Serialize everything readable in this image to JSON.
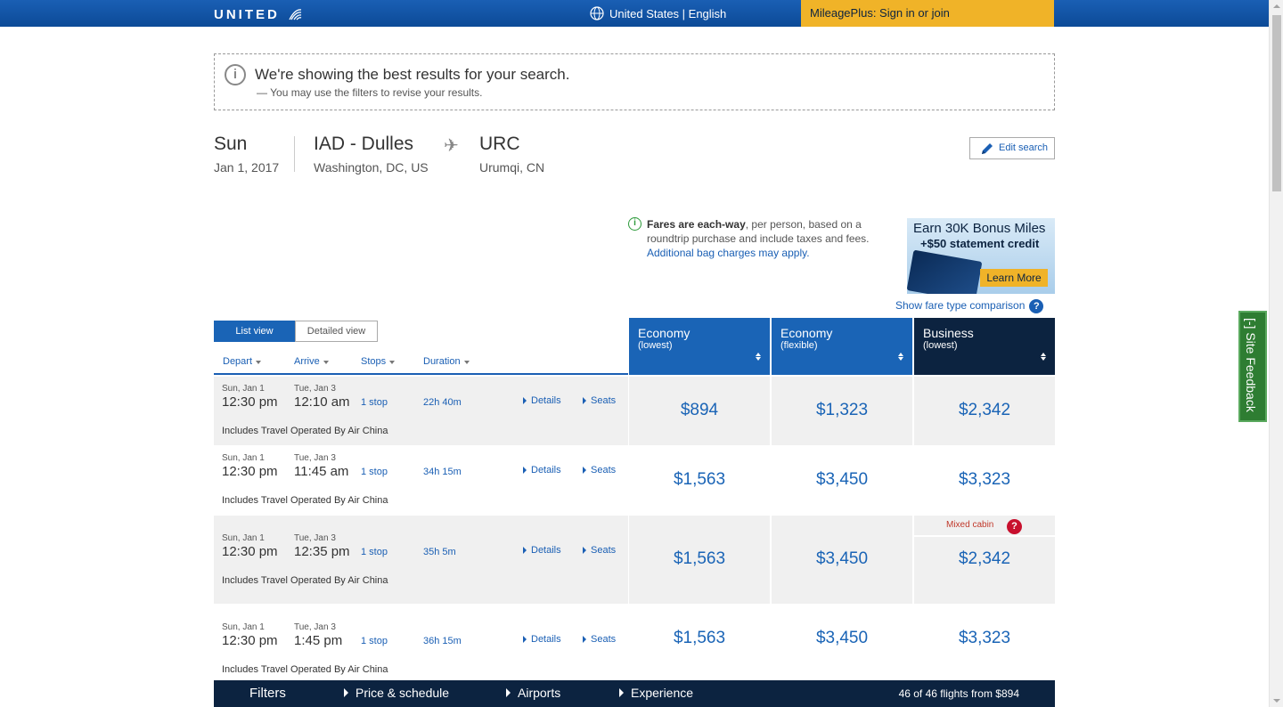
{
  "header": {
    "logo": "UNITED",
    "locale": "United States | English",
    "mileageplus": "MileagePlus: Sign in or join"
  },
  "notice": {
    "title": "We're showing the best results for your search.",
    "subtitle": "— You may use the filters to revise your results."
  },
  "route": {
    "day": "Sun",
    "date": "Jan 1, 2017",
    "origin_code": "IAD - Dulles",
    "origin_city": "Washington, DC, US",
    "dest_code": "URC",
    "dest_city": "Urumqi, CN",
    "edit_label": "Edit search"
  },
  "fares_note": {
    "bold": "Fares are each-way",
    "text": ", per person, based on a roundtrip purchase and include taxes and fees.",
    "link": "Additional bag charges may apply."
  },
  "ad": {
    "line1": "Earn 30K Bonus Miles",
    "line2": "+$50 statement credit",
    "button": "Learn More"
  },
  "compare_link": "Show fare type comparison",
  "feedback": "[-] Site Feedback",
  "views": {
    "list": "List view",
    "detailed": "Detailed view"
  },
  "sort": {
    "depart": "Depart",
    "arrive": "Arrive",
    "stops": "Stops",
    "duration": "Duration"
  },
  "columns": [
    {
      "title": "Economy",
      "sub": "(lowest)",
      "color": "#1a64b6"
    },
    {
      "title": "Economy",
      "sub": "(flexible)",
      "color": "#1a64b6"
    },
    {
      "title": "Business",
      "sub": "(lowest)",
      "color": "#0c2340"
    }
  ],
  "links": {
    "details": "Details",
    "seats": "Seats"
  },
  "flights": [
    {
      "dep_date": "Sun, Jan 1",
      "dep_time": "12:30 pm",
      "arr_date": "Tue, Jan 3",
      "arr_time": "12:10 am",
      "stops": "1 stop",
      "duration": "22h 40m",
      "operated": "Includes Travel Operated By Air China",
      "prices": [
        "$894",
        "$1,323",
        "$2,342"
      ],
      "mixed": ""
    },
    {
      "dep_date": "Sun, Jan 1",
      "dep_time": "12:30 pm",
      "arr_date": "Tue, Jan 3",
      "arr_time": "11:45 am",
      "stops": "1 stop",
      "duration": "34h 15m",
      "operated": "Includes Travel Operated By Air China",
      "prices": [
        "$1,563",
        "$3,450",
        "$3,323"
      ],
      "mixed": ""
    },
    {
      "dep_date": "Sun, Jan 1",
      "dep_time": "12:30 pm",
      "arr_date": "Tue, Jan 3",
      "arr_time": "12:35 pm",
      "stops": "1 stop",
      "duration": "35h 5m",
      "operated": "Includes Travel Operated By Air China",
      "prices": [
        "$1,563",
        "$3,450",
        "$2,342"
      ],
      "mixed": "Mixed cabin"
    },
    {
      "dep_date": "Sun, Jan 1",
      "dep_time": "12:30 pm",
      "arr_date": "Tue, Jan 3",
      "arr_time": "1:45 pm",
      "stops": "1 stop",
      "duration": "36h 15m",
      "operated": "Includes Travel Operated By Air China",
      "prices": [
        "$1,563",
        "$3,450",
        "$3,323"
      ],
      "mixed": ""
    }
  ],
  "filterbar": {
    "filters": "Filters",
    "price": "Price & schedule",
    "airports": "Airports",
    "experience": "Experience",
    "count": "46 of 46 flights from $894"
  }
}
